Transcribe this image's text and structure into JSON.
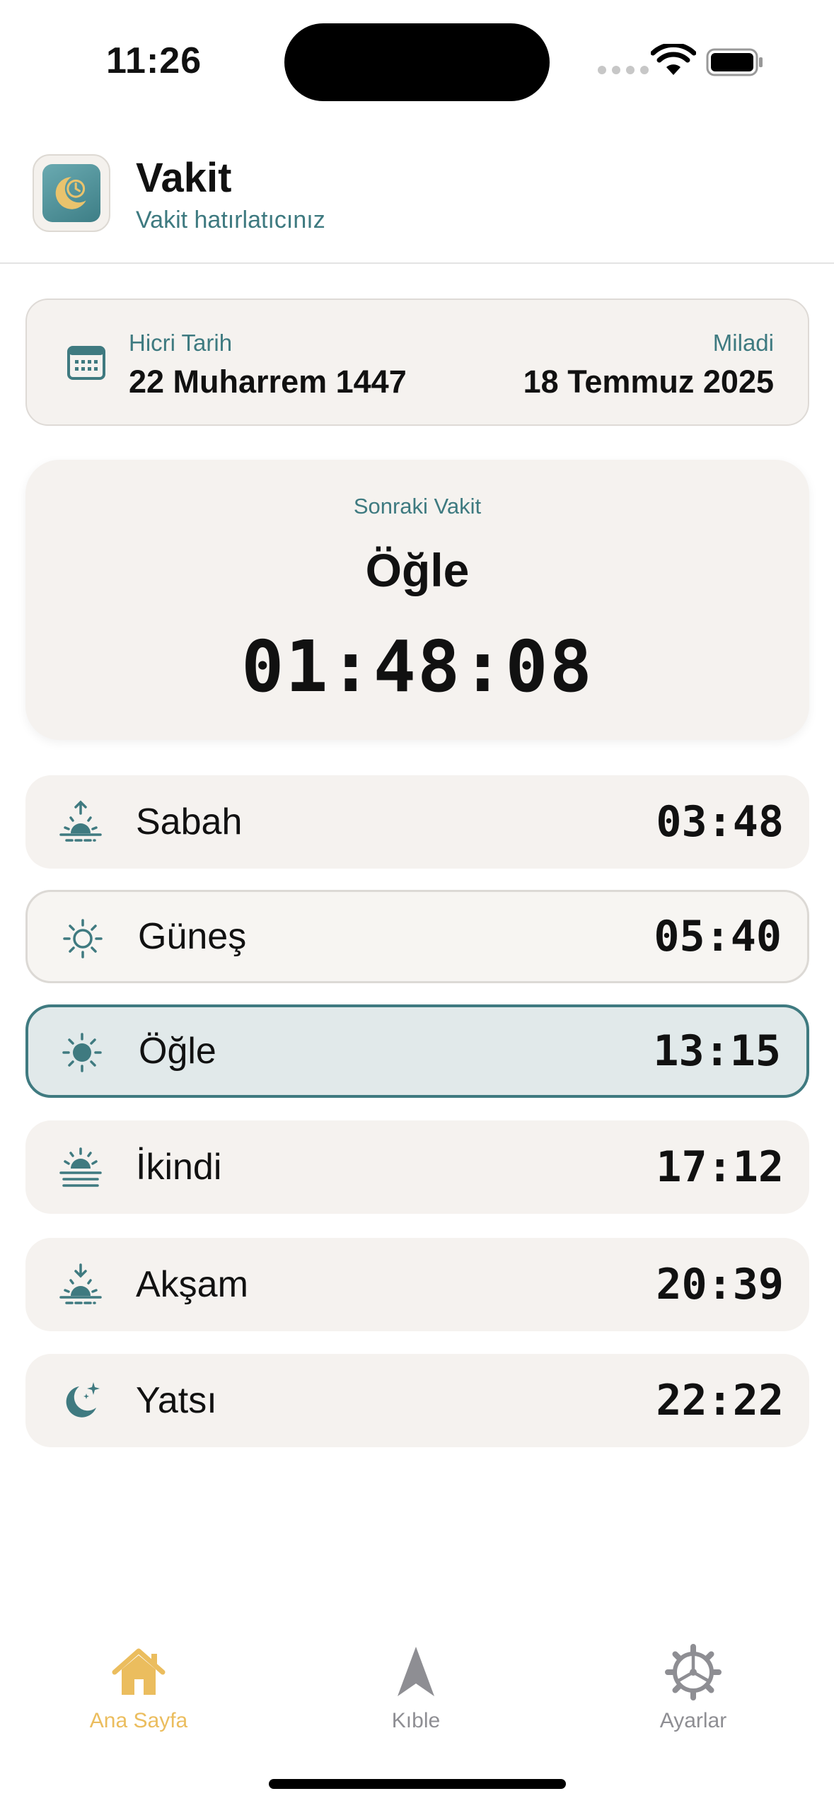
{
  "status_bar": {
    "time": "11:26",
    "icons": [
      "cellular-dots-icon",
      "wifi-icon",
      "battery-icon"
    ]
  },
  "header": {
    "app_icon": "crescent-clock-icon",
    "title": "Vakit",
    "subtitle": "Vakit hatırlatıcınız"
  },
  "date_card": {
    "icon": "calendar-icon",
    "hijri_label": "Hicri Tarih",
    "hijri_value": "22 Muharrem 1447",
    "gregorian_label": "Miladi",
    "gregorian_value": "18 Temmuz 2025"
  },
  "next_prayer": {
    "label": "Sonraki Vakit",
    "name": "Öğle",
    "countdown": "01:48:08"
  },
  "prayers": [
    {
      "name": "Sabah",
      "time": "03:48",
      "icon": "sunrise-arrow-up-icon",
      "state": "normal"
    },
    {
      "name": "Güneş",
      "time": "05:40",
      "icon": "sun-outline-icon",
      "state": "outlined"
    },
    {
      "name": "Öğle",
      "time": "13:15",
      "icon": "sun-filled-icon",
      "state": "active"
    },
    {
      "name": "İkindi",
      "time": "17:12",
      "icon": "sun-haze-icon",
      "state": "normal"
    },
    {
      "name": "Akşam",
      "time": "20:39",
      "icon": "sunset-arrow-down-icon",
      "state": "normal"
    },
    {
      "name": "Yatsı",
      "time": "22:22",
      "icon": "moon-stars-icon",
      "state": "normal"
    }
  ],
  "tab_bar": {
    "tabs": [
      {
        "label": "Ana Sayfa",
        "icon": "house-icon",
        "active": true
      },
      {
        "label": "Kıble",
        "icon": "compass-arrow-icon",
        "active": false
      },
      {
        "label": "Ayarlar",
        "icon": "gear-icon",
        "active": false
      }
    ]
  },
  "colors": {
    "accent": "#3f7a80",
    "card_background": "#f5f2ef",
    "active_row_background": "#e1e9ea",
    "active_tab": "#ebbd5e",
    "inactive_tab": "#8e8e93"
  }
}
